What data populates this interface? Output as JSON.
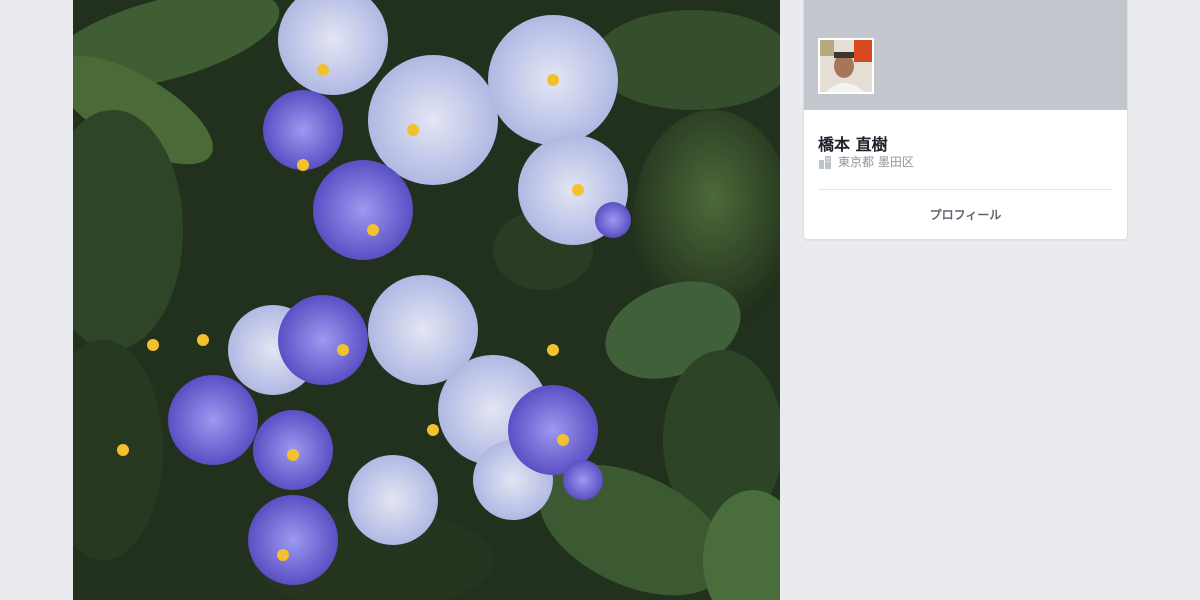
{
  "profile": {
    "name": "橋本 直樹",
    "location": "東京都 墨田区",
    "profile_button": "プロフィール"
  },
  "icons": {
    "location": "building-icon"
  },
  "colors": {
    "page_bg": "#e9ebee",
    "cover_bg": "#c3c6cd",
    "name_text": "#1d2129",
    "secondary_text": "#90949c"
  }
}
